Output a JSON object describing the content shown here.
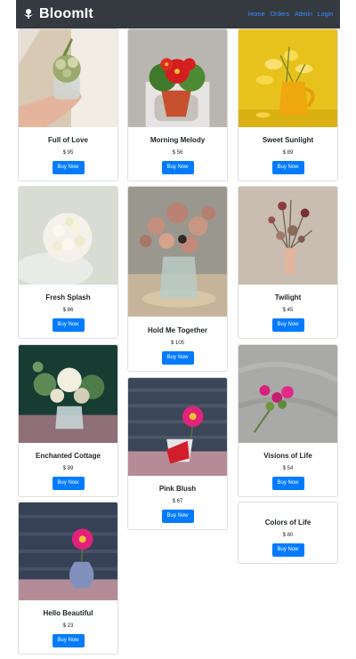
{
  "app": {
    "brand": "BloomIt",
    "nav": [
      "Home",
      "Orders",
      "Admin",
      "Login"
    ]
  },
  "products": [
    {
      "name": "Full of Love",
      "price": "$ 95",
      "cta": "Buy Now"
    },
    {
      "name": "Morning Melody",
      "price": "$ 56",
      "cta": "Buy Now"
    },
    {
      "name": "Sweet Sunlight",
      "price": "$ 89",
      "cta": "Buy Now"
    },
    {
      "name": "Fresh Splash",
      "price": "$ 86",
      "cta": "Buy Now"
    },
    {
      "name": "Hold Me Together",
      "price": "$ 105",
      "cta": "Buy Now"
    },
    {
      "name": "Twilight",
      "price": "$ 45",
      "cta": "Buy Now"
    },
    {
      "name": "Enchanted Cottage",
      "price": "$ 89",
      "cta": "Buy Now"
    },
    {
      "name": "Pink Blush",
      "price": "$ 67",
      "cta": "Buy Now"
    },
    {
      "name": "Visions of Life",
      "price": "$ 54",
      "cta": "Buy Now"
    },
    {
      "name": "Hello Beautiful",
      "price": "$ 23",
      "cta": "Buy Now"
    },
    {
      "name": "Colors of Life",
      "price": "$ 80",
      "cta": "Buy Now"
    }
  ],
  "colors": {
    "navbar": "#343a40",
    "link": "#3d8bfd",
    "button": "#007bff"
  }
}
